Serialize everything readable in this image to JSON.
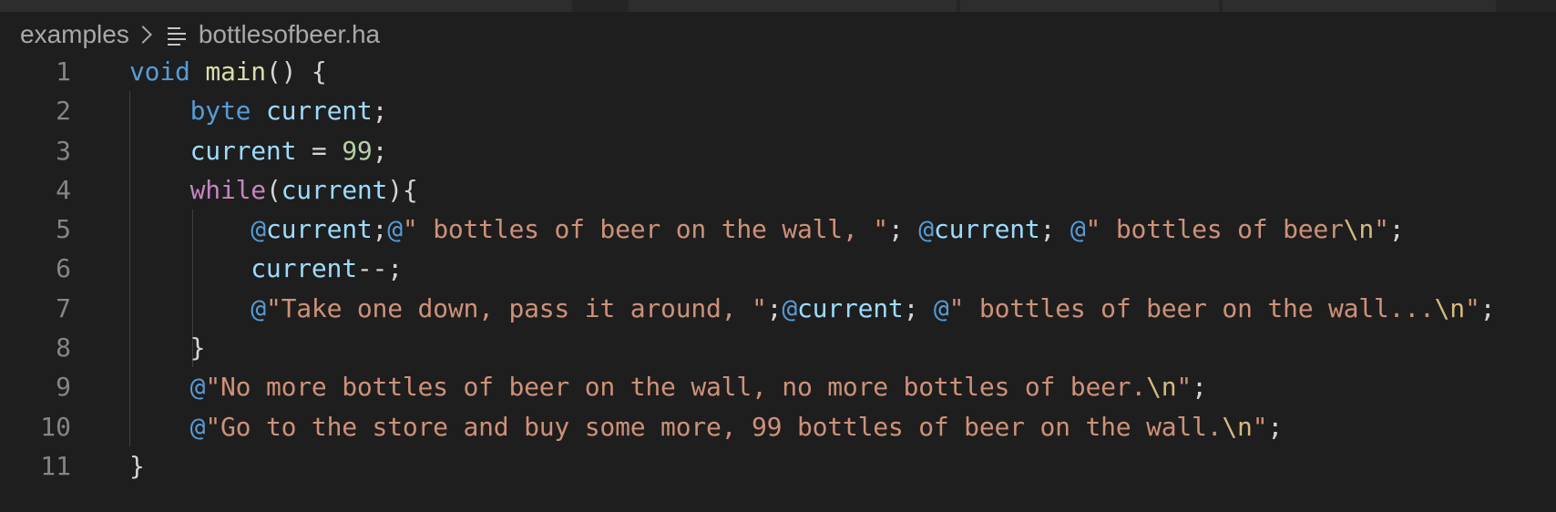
{
  "breadcrumb": {
    "folder": "examples",
    "file": "bottlesofbeer.ha",
    "file_icon": "list-icon"
  },
  "colors": {
    "background": "#1e1e1e",
    "keyword": "#569cd6",
    "control": "#c586c0",
    "variable": "#9cdcfe",
    "number": "#b5cea8",
    "string": "#ce9178",
    "escape": "#d7ba7d"
  },
  "lines": [
    {
      "n": "1",
      "tokens": [
        {
          "t": "kw",
          "v": "void"
        },
        {
          "t": "pun",
          "v": " "
        },
        {
          "t": "fn",
          "v": "main"
        },
        {
          "t": "pun",
          "v": "() {"
        }
      ]
    },
    {
      "n": "2",
      "tokens": [
        {
          "t": "pun",
          "v": "    "
        },
        {
          "t": "kw",
          "v": "byte"
        },
        {
          "t": "pun",
          "v": " "
        },
        {
          "t": "var",
          "v": "current"
        },
        {
          "t": "pun",
          "v": ";"
        }
      ]
    },
    {
      "n": "3",
      "tokens": [
        {
          "t": "pun",
          "v": "    "
        },
        {
          "t": "var",
          "v": "current"
        },
        {
          "t": "pun",
          "v": " = "
        },
        {
          "t": "num",
          "v": "99"
        },
        {
          "t": "pun",
          "v": ";"
        }
      ]
    },
    {
      "n": "4",
      "tokens": [
        {
          "t": "pun",
          "v": "    "
        },
        {
          "t": "ctl",
          "v": "while"
        },
        {
          "t": "pun",
          "v": "("
        },
        {
          "t": "var",
          "v": "current"
        },
        {
          "t": "pun",
          "v": "){"
        }
      ]
    },
    {
      "n": "5",
      "tokens": [
        {
          "t": "pun",
          "v": "        "
        },
        {
          "t": "at",
          "v": "@"
        },
        {
          "t": "var",
          "v": "current"
        },
        {
          "t": "pun",
          "v": ";"
        },
        {
          "t": "at",
          "v": "@"
        },
        {
          "t": "str",
          "v": "\" bottles of beer on the wall, \""
        },
        {
          "t": "pun",
          "v": "; "
        },
        {
          "t": "at",
          "v": "@"
        },
        {
          "t": "var",
          "v": "current"
        },
        {
          "t": "pun",
          "v": "; "
        },
        {
          "t": "at",
          "v": "@"
        },
        {
          "t": "str",
          "v": "\" bottles of beer"
        },
        {
          "t": "esc",
          "v": "\\n"
        },
        {
          "t": "str",
          "v": "\""
        },
        {
          "t": "pun",
          "v": ";"
        }
      ]
    },
    {
      "n": "6",
      "tokens": [
        {
          "t": "pun",
          "v": "        "
        },
        {
          "t": "var",
          "v": "current"
        },
        {
          "t": "pun",
          "v": "--;"
        }
      ]
    },
    {
      "n": "7",
      "tokens": [
        {
          "t": "pun",
          "v": "        "
        },
        {
          "t": "at",
          "v": "@"
        },
        {
          "t": "str",
          "v": "\"Take one down, pass it around, \""
        },
        {
          "t": "pun",
          "v": ";"
        },
        {
          "t": "at",
          "v": "@"
        },
        {
          "t": "var",
          "v": "current"
        },
        {
          "t": "pun",
          "v": "; "
        },
        {
          "t": "at",
          "v": "@"
        },
        {
          "t": "str",
          "v": "\" bottles of beer on the wall..."
        },
        {
          "t": "esc",
          "v": "\\n"
        },
        {
          "t": "str",
          "v": "\""
        },
        {
          "t": "pun",
          "v": ";"
        }
      ]
    },
    {
      "n": "8",
      "tokens": [
        {
          "t": "pun",
          "v": "    }"
        }
      ]
    },
    {
      "n": "9",
      "tokens": [
        {
          "t": "pun",
          "v": "    "
        },
        {
          "t": "at",
          "v": "@"
        },
        {
          "t": "str",
          "v": "\"No more bottles of beer on the wall, no more bottles of beer."
        },
        {
          "t": "esc",
          "v": "\\n"
        },
        {
          "t": "str",
          "v": "\""
        },
        {
          "t": "pun",
          "v": ";"
        }
      ]
    },
    {
      "n": "10",
      "tokens": [
        {
          "t": "pun",
          "v": "    "
        },
        {
          "t": "at",
          "v": "@"
        },
        {
          "t": "str",
          "v": "\"Go to the store and buy some more, 99 bottles of beer on the wall."
        },
        {
          "t": "esc",
          "v": "\\n"
        },
        {
          "t": "str",
          "v": "\""
        },
        {
          "t": "pun",
          "v": ";"
        }
      ]
    },
    {
      "n": "11",
      "tokens": [
        {
          "t": "pun",
          "v": "}"
        }
      ]
    }
  ]
}
